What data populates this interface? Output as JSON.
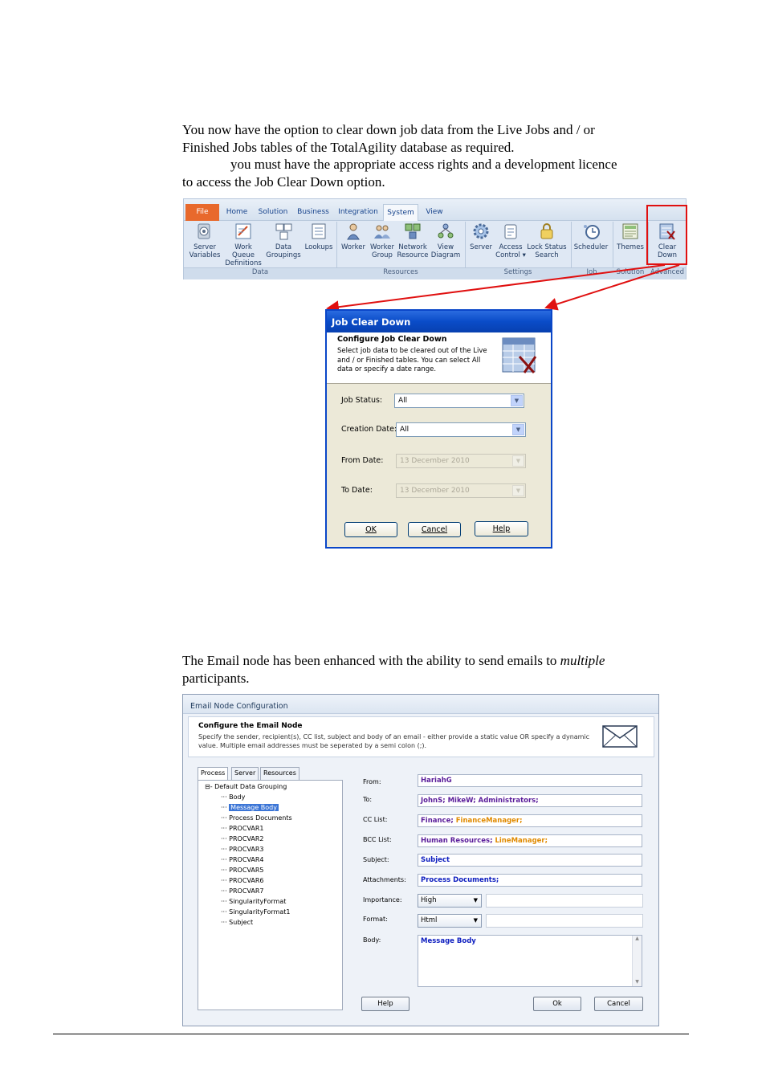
{
  "intro": {
    "line1": "You now have the option to clear down job data from the Live Jobs and / or",
    "line2": "Finished Jobs tables of the TotalAgility database as required.",
    "line3": "you must have the appropriate access rights and a development licence",
    "line4": "to access the Job Clear Down option."
  },
  "ribbon": {
    "tabs": [
      "File",
      "Home",
      "Solution",
      "Business",
      "Integration",
      "System",
      "View"
    ],
    "active_tab": "System",
    "buttons": [
      {
        "label1": "Server",
        "label2": "Variables",
        "icon": "server-variables-icon"
      },
      {
        "label1": "Work Queue",
        "label2": "Definitions",
        "icon": "work-queue-icon"
      },
      {
        "label1": "Data",
        "label2": "Groupings",
        "icon": "data-groupings-icon"
      },
      {
        "label1": "Lookups",
        "label2": "",
        "icon": "lookups-icon"
      },
      {
        "label1": "Worker",
        "label2": "",
        "icon": "worker-icon"
      },
      {
        "label1": "Worker",
        "label2": "Group",
        "icon": "worker-group-icon"
      },
      {
        "label1": "Network",
        "label2": "Resource",
        "icon": "network-resource-icon"
      },
      {
        "label1": "View",
        "label2": "Diagram",
        "icon": "view-diagram-icon"
      },
      {
        "label1": "Server",
        "label2": "",
        "icon": "server-gear-icon"
      },
      {
        "label1": "Access",
        "label2": "Control ▾",
        "icon": "access-control-icon"
      },
      {
        "label1": "Lock Status",
        "label2": "Search",
        "icon": "lock-status-icon"
      },
      {
        "label1": "Scheduler",
        "label2": "",
        "icon": "scheduler-icon"
      },
      {
        "label1": "Themes",
        "label2": "",
        "icon": "themes-icon"
      },
      {
        "label1": "Clear",
        "label2": "Down",
        "icon": "clear-down-icon"
      }
    ],
    "groups": [
      "Data",
      "Resources",
      "Settings",
      "Job",
      "Solution",
      "Advanced"
    ]
  },
  "job_clear_down": {
    "title": "Job Clear Down",
    "header_title": "Configure Job Clear Down",
    "header_desc": "Select job data to be cleared out of the Live and / or Finished tables. You can select All data or specify a date range.",
    "job_status_label": "Job Status:",
    "job_status_value": "All",
    "creation_date_label": "Creation Date:",
    "creation_date_value": "All",
    "from_date_label": "From Date:",
    "from_date_value": "13 December 2010",
    "to_date_label": "To Date:",
    "to_date_value": "13 December 2010",
    "ok": "OK",
    "cancel": "Cancel",
    "help": "Help"
  },
  "email_intro": {
    "text": "The Email node has been enhanced with the ability to send emails to",
    "emph": "multiple",
    "line2": "participants."
  },
  "email_dialog": {
    "title": "Email Node Configuration",
    "header_title": "Configure the Email Node",
    "header_desc": "Specify the sender, recipient(s), CC list, subject and body of an email - either provide a static value OR specify a dynamic value. Multiple email addresses must be seperated by a semi colon (;).",
    "tabs": [
      "Process",
      "Server",
      "Resources"
    ],
    "tree_root": "Default Data Grouping",
    "tree_items": [
      "Body",
      "Message Body",
      "Process Documents",
      "PROCVAR1",
      "PROCVAR2",
      "PROCVAR3",
      "PROCVAR4",
      "PROCVAR5",
      "PROCVAR6",
      "PROCVAR7",
      "SingularityFormat",
      "SingularityFormat1",
      "Subject"
    ],
    "selected_item": "Message Body",
    "labels": {
      "from": "From:",
      "to": "To:",
      "cc": "CC List:",
      "bcc": "BCC List:",
      "subject": "Subject:",
      "attachments": "Attachments:",
      "importance": "Importance:",
      "format": "Format:",
      "body": "Body:"
    },
    "from_value": "HariahG",
    "to_value": "JohnS; MikeW; Administrators;",
    "cc_value_1": "Finance;",
    "cc_value_2": "FinanceManager;",
    "bcc_value_1": "Human Resources;",
    "bcc_value_2": "LineManager;",
    "subject_value": "Subject",
    "attachments_value": "Process Documents;",
    "importance_value": "High",
    "format_value": "Html",
    "body_value": "Message Body",
    "help": "Help",
    "ok": "Ok",
    "cancel": "Cancel"
  },
  "colors": {
    "highlight": "#e01010",
    "xp_title": "#0a4cc8",
    "file_tab": "#e8692c"
  }
}
